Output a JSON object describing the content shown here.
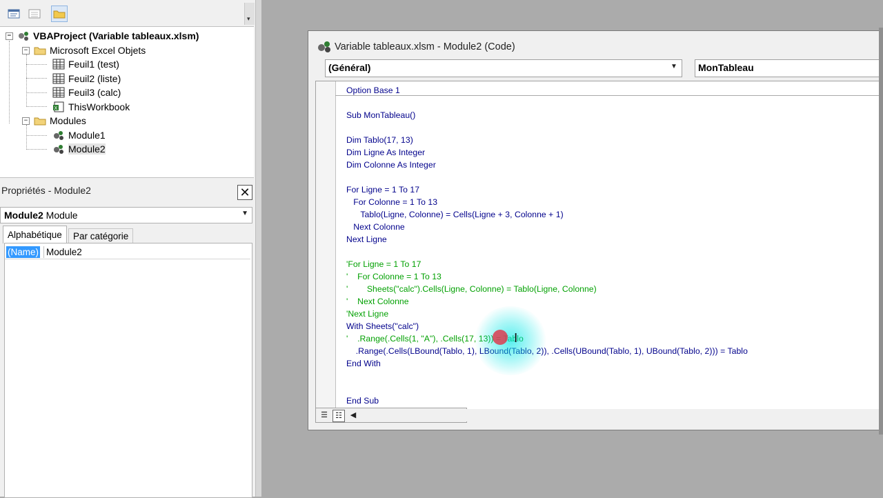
{
  "project_tree": {
    "root": "VBAProject (Variable tableaux.xlsm)",
    "excel_objects_folder": "Microsoft Excel Objets",
    "sheets": [
      "Feuil1 (test)",
      "Feuil2 (liste)",
      "Feuil3 (calc)"
    ],
    "workbook": "ThisWorkbook",
    "modules_folder": "Modules",
    "modules": [
      "Module1",
      "Module2"
    ]
  },
  "properties": {
    "title": "Propriétés - Module2",
    "object_name": "Module2",
    "object_type": "Module",
    "tabs": [
      "Alphabétique",
      "Par catégorie"
    ],
    "rows": [
      {
        "name": "(Name)",
        "value": "Module2"
      }
    ]
  },
  "code_window": {
    "title": "Variable tableaux.xlsm - Module2 (Code)",
    "object_combo": "(Général)",
    "proc_combo": "MonTableau"
  },
  "code": {
    "l1": "Option Base 1",
    "l2": "Sub MonTableau()",
    "l3": "Dim Tablo(17, 13)",
    "l4": "Dim Ligne As Integer",
    "l5": "Dim Colonne As Integer",
    "l6": "For Ligne = 1 To 17",
    "l7": "   For Colonne = 1 To 13",
    "l8": "      Tablo(Ligne, Colonne) = Cells(Ligne + 3, Colonne + 1)",
    "l9": "   Next Colonne",
    "l10": "Next Ligne",
    "l11": "'For Ligne = 1 To 17",
    "l12": "'    For Colonne = 1 To 13",
    "l13": "'        Sheets(\"calc\").Cells(Ligne, Colonne) = Tablo(Ligne, Colonne)",
    "l14": "'    Next Colonne",
    "l15": "'Next Ligne",
    "l16": "With Sheets(\"calc\")",
    "l17": "'    .Range(.Cells(1, \"A\"), .Cells(17, 13)) = Tablo",
    "l18": "    .Range(.Cells(LBound(Tablo, 1), LBound(Tablo, 2)), .Cells(UBound(Tablo, 1), UBound(Tablo, 2))) = Tablo",
    "l19": "End With",
    "l20": "End Sub"
  }
}
